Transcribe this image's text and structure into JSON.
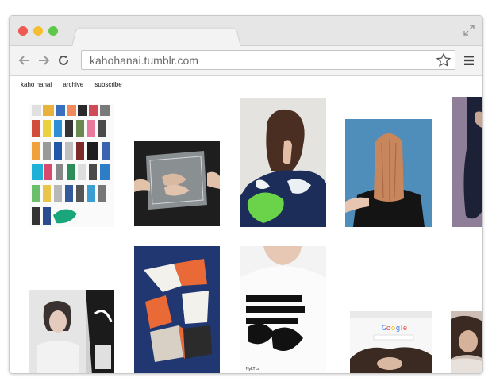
{
  "window": {
    "traffic_lights": {
      "close": "#ee5a52",
      "minimize": "#f6be2f",
      "maximize": "#5fc84a"
    }
  },
  "toolbar": {
    "url": "kahohanai.tumblr.com",
    "back_icon": "back-arrow-icon",
    "forward_icon": "forward-arrow-icon",
    "reload_icon": "reload-icon",
    "bookmark_icon": "star-icon",
    "menu_icon": "hamburger-menu-icon"
  },
  "site": {
    "nav": [
      "kaho hanai",
      "archive",
      "subscribe"
    ]
  },
  "gallery": {
    "items": [
      {
        "name": "fashion-lineup-grid",
        "description": ""
      },
      {
        "name": "clear-bag-hands"
      },
      {
        "name": "woman-painted-jacket"
      },
      {
        "name": "hair-covered-face"
      },
      {
        "name": "partial-figure"
      },
      {
        "name": "woman-portrait-magazine"
      },
      {
        "name": "geometric-collage"
      },
      {
        "name": "graphic-tshirt"
      },
      {
        "name": "google-screen-hair"
      },
      {
        "name": "partial-portrait"
      }
    ],
    "tshirt_text": "NyLTLa"
  }
}
